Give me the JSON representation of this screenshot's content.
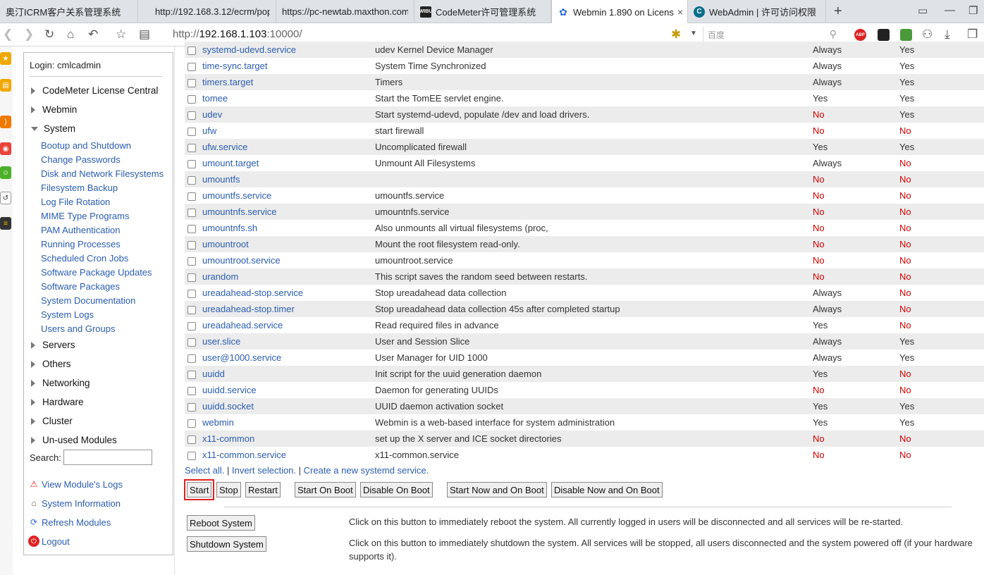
{
  "browser": {
    "tabs": [
      {
        "label": "奥汀ICRM客户关系管理系统",
        "icon": "page-icon",
        "active": false
      },
      {
        "label": "http://192.168.3.12/ecrm/popu",
        "icon": "page-icon",
        "active": false
      },
      {
        "label": "https://pc-newtab.maxthon.com",
        "icon": "page-icon",
        "active": false
      },
      {
        "label": "CodeMeter许可管理系统",
        "icon": "wibu-icon",
        "active": false
      },
      {
        "label": "Webmin 1.890 on Licens",
        "icon": "webmin-icon",
        "active": true
      },
      {
        "label": "WebAdmin | 许可访问权限",
        "icon": "codemeter-icon",
        "active": false
      }
    ],
    "new_tab": "+",
    "tab_close": "×",
    "url_prefix": "http://",
    "url_host": "192.168.1.103",
    "url_rest": ":10000/",
    "search_placeholder": "百度",
    "ext_abp": "ABP"
  },
  "sidebar": {
    "login": "Login: cmlcadmin",
    "categories_top": [
      {
        "label": "CodeMeter License Central",
        "expanded": false
      },
      {
        "label": "Webmin",
        "expanded": false
      },
      {
        "label": "System",
        "expanded": true
      }
    ],
    "system_modules": [
      "Bootup and Shutdown",
      "Change Passwords",
      "Disk and Network Filesystems",
      "Filesystem Backup",
      "Log File Rotation",
      "MIME Type Programs",
      "PAM Authentication",
      "Running Processes",
      "Scheduled Cron Jobs",
      "Software Package Updates",
      "Software Packages",
      "System Documentation",
      "System Logs",
      "Users and Groups"
    ],
    "categories_bottom": [
      "Servers",
      "Others",
      "Networking",
      "Hardware",
      "Cluster",
      "Un-used Modules"
    ],
    "search_label": "Search:",
    "search_value": "",
    "links": [
      {
        "label": "View Module's Logs",
        "icon": "warning-icon"
      },
      {
        "label": "System Information",
        "icon": "home-icon"
      },
      {
        "label": "Refresh Modules",
        "icon": "refresh-icon"
      },
      {
        "label": "Logout",
        "icon": "power-icon"
      }
    ]
  },
  "services": [
    {
      "name": "systemd-udevd.service",
      "desc": "udev Kernel Device Manager",
      "boot": "Always",
      "running": "Yes"
    },
    {
      "name": "time-sync.target",
      "desc": "System Time Synchronized",
      "boot": "Always",
      "running": "Yes"
    },
    {
      "name": "timers.target",
      "desc": "Timers",
      "boot": "Always",
      "running": "Yes"
    },
    {
      "name": "tomee",
      "desc": "Start the TomEE servlet engine.",
      "boot": "Yes",
      "running": "Yes"
    },
    {
      "name": "udev",
      "desc": "Start systemd-udevd, populate /dev and load drivers.",
      "boot": "No",
      "running": "Yes"
    },
    {
      "name": "ufw",
      "desc": "start firewall",
      "boot": "No",
      "running": "No"
    },
    {
      "name": "ufw.service",
      "desc": "Uncomplicated firewall",
      "boot": "Yes",
      "running": "Yes"
    },
    {
      "name": "umount.target",
      "desc": "Unmount All Filesystems",
      "boot": "Always",
      "running": "No"
    },
    {
      "name": "umountfs",
      "desc": "",
      "boot": "No",
      "running": "No"
    },
    {
      "name": "umountfs.service",
      "desc": "umountfs.service",
      "boot": "No",
      "running": "No"
    },
    {
      "name": "umountnfs.service",
      "desc": "umountnfs.service",
      "boot": "No",
      "running": "No"
    },
    {
      "name": "umountnfs.sh",
      "desc": "Also unmounts all virtual filesystems (proc,",
      "boot": "No",
      "running": "No"
    },
    {
      "name": "umountroot",
      "desc": "Mount the root filesystem read-only.",
      "boot": "No",
      "running": "No"
    },
    {
      "name": "umountroot.service",
      "desc": "umountroot.service",
      "boot": "No",
      "running": "No"
    },
    {
      "name": "urandom",
      "desc": "This script saves the random seed between restarts.",
      "boot": "No",
      "running": "No"
    },
    {
      "name": "ureadahead-stop.service",
      "desc": "Stop ureadahead data collection",
      "boot": "Always",
      "running": "No"
    },
    {
      "name": "ureadahead-stop.timer",
      "desc": "Stop ureadahead data collection 45s after completed startup",
      "boot": "Always",
      "running": "No"
    },
    {
      "name": "ureadahead.service",
      "desc": "Read required files in advance",
      "boot": "Yes",
      "running": "No"
    },
    {
      "name": "user.slice",
      "desc": "User and Session Slice",
      "boot": "Always",
      "running": "Yes"
    },
    {
      "name": "user@1000.service",
      "desc": "User Manager for UID 1000",
      "boot": "Always",
      "running": "Yes"
    },
    {
      "name": "uuidd",
      "desc": "Init script for the uuid generation daemon",
      "boot": "Yes",
      "running": "No"
    },
    {
      "name": "uuidd.service",
      "desc": "Daemon for generating UUIDs",
      "boot": "No",
      "running": "No"
    },
    {
      "name": "uuidd.socket",
      "desc": "UUID daemon activation socket",
      "boot": "Yes",
      "running": "Yes"
    },
    {
      "name": "webmin",
      "desc": "Webmin is a web-based interface for system administration",
      "boot": "Yes",
      "running": "Yes"
    },
    {
      "name": "x11-common",
      "desc": "set up the X server and ICE socket directories",
      "boot": "No",
      "running": "No"
    },
    {
      "name": "x11-common.service",
      "desc": "x11-common.service",
      "boot": "No",
      "running": "No"
    }
  ],
  "selection": {
    "select_all": "Select all.",
    "separator": " | ",
    "invert": "Invert selection.",
    "create": "Create a new systemd service."
  },
  "actions": {
    "start": "Start",
    "stop": "Stop",
    "restart": "Restart",
    "start_on_boot": "Start On Boot",
    "disable_on_boot": "Disable On Boot",
    "start_now_and_on_boot": "Start Now and On Boot",
    "disable_now_and_on_boot": "Disable Now and On Boot"
  },
  "system": {
    "reboot_label": "Reboot System",
    "reboot_desc": "Click on this button to immediately reboot the system. All currently logged in users will be disconnected and all services will be re-started.",
    "shutdown_label": "Shutdown System",
    "shutdown_desc": "Click on this button to immediately shutdown the system. All services will be stopped, all users disconnected and the system powered off (if your hardware supports it)."
  },
  "colors": {
    "link": "#2a5db0",
    "no": "#d00000",
    "row_alt": "#ececec",
    "focus_outline": "#e02020"
  }
}
